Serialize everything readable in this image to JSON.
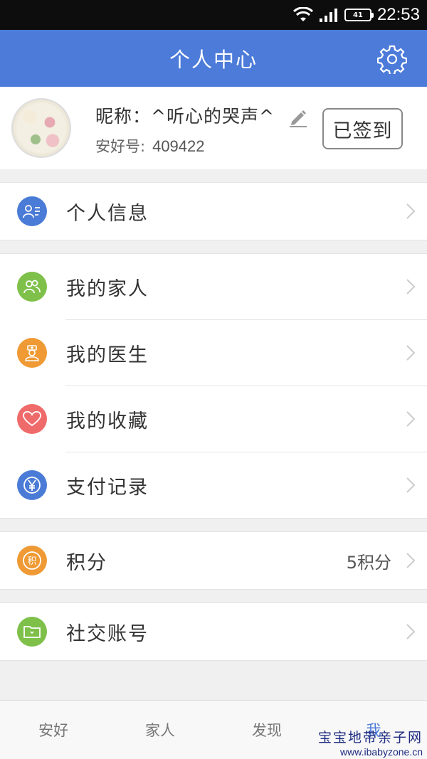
{
  "status_bar": {
    "time": "22:53",
    "battery_label": "41"
  },
  "header": {
    "title": "个人中心",
    "settings_icon": "gear-icon"
  },
  "profile": {
    "nickname": "昵称：^听心的哭声^",
    "anhao_label": "安好号:",
    "anhao_number": "409422",
    "edit_icon": "pencil-icon",
    "sign_in_button": "已签到"
  },
  "menu": {
    "personal_info": {
      "label": "个人信息",
      "icon": "contact-card-icon",
      "color": "#4a7bd6"
    },
    "my_family": {
      "label": "我的家人",
      "icon": "people-icon",
      "color": "#7ec04a"
    },
    "my_doctor": {
      "label": "我的医生",
      "icon": "doctor-icon",
      "color": "#ef9a34"
    },
    "my_favorites": {
      "label": "我的收藏",
      "icon": "heart-icon",
      "color": "#ef6b6b"
    },
    "payment_records": {
      "label": "支付记录",
      "icon": "yuan-icon",
      "color": "#4a7bd6"
    },
    "points": {
      "label": "积分",
      "value": "5积分",
      "icon": "points-icon",
      "color": "#ef9a34"
    },
    "social_accounts": {
      "label": "社交账号",
      "icon": "folder-icon",
      "color": "#7ec04a"
    }
  },
  "tab_bar": {
    "tabs": [
      {
        "label": "安好"
      },
      {
        "label": "家人"
      },
      {
        "label": "发现"
      },
      {
        "label": "我"
      }
    ],
    "active_color": "#4c7bd9"
  },
  "watermark": {
    "line1": "宝宝地带亲子网",
    "line2": "www.ibabyzone.cn"
  }
}
